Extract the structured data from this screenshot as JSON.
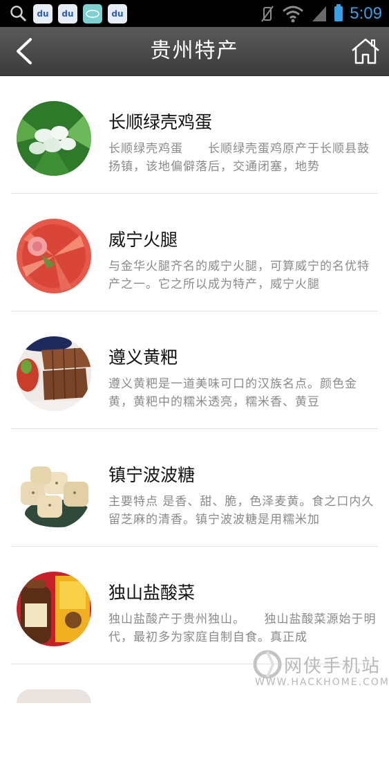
{
  "status_bar": {
    "time": "5:09",
    "apps": [
      {
        "icon": "search-icon"
      },
      {
        "icon": "baidu-paw-icon",
        "text": "du"
      },
      {
        "icon": "baidu-paw-icon",
        "text": "du"
      },
      {
        "icon": "teal-app-icon"
      },
      {
        "icon": "baidu-paw-icon",
        "text": "du"
      }
    ]
  },
  "header": {
    "title": "贵州特产",
    "back_icon": "chevron-left-icon",
    "home_icon": "home-icon"
  },
  "items": [
    {
      "name": "长顺绿壳鸡蛋",
      "desc": "长顺绿壳鸡蛋　　长顺绿壳蛋鸡原产于长顺县鼓扬镇，该地偏僻落后，交通闭塞，地势",
      "image": "green-shell-eggs"
    },
    {
      "name": "威宁火腿",
      "desc": "与金华火腿齐名的威宁火腿，可算威宁的名优特产之一。它之所以成为特产，威宁火腿",
      "image": "sliced-ham"
    },
    {
      "name": "遵义黄粑",
      "desc": "遵义黄粑是一道美味可口的汉族名点。颜色金黄，黄粑中的糯米透亮，糯米香、黄豆",
      "image": "huangba-cake"
    },
    {
      "name": "镇宁波波糖",
      "desc": "主要特点 是香、甜、脆，色泽麦黄。食之口内久留芝麻的清香。镇宁波波糖是用糯米加",
      "image": "bobo-candy"
    },
    {
      "name": "独山盐酸菜",
      "desc": "独山盐酸产于贵州独山。　　独山盐酸菜源始于明代，最初多为家庭自制自食。真正成",
      "image": "pickled-vegetable-jar"
    }
  ],
  "watermark": {
    "name": "网侠手机站",
    "url": "WWW.HACKHOME.COM"
  }
}
